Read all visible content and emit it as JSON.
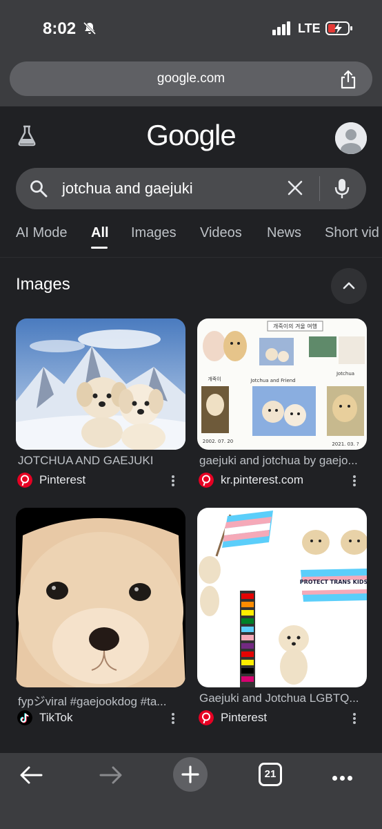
{
  "status_bar": {
    "time": "8:02",
    "network": "LTE"
  },
  "address_bar": {
    "url": "google.com"
  },
  "header": {
    "logo": "Google"
  },
  "search": {
    "query": "jotchua and gaejuki"
  },
  "tabs": [
    {
      "label": "AI Mode"
    },
    {
      "label": "All"
    },
    {
      "label": "Images"
    },
    {
      "label": "Videos"
    },
    {
      "label": "News"
    },
    {
      "label": "Short vid"
    }
  ],
  "active_tab": "All",
  "images_section": {
    "title": "Images",
    "results": [
      {
        "caption": "JOTCHUA AND GAEJUKI",
        "source": "Pinterest",
        "source_icon": "pinterest-icon"
      },
      {
        "caption": "gaejuki and jotchua by gaejo...",
        "source": "kr.pinterest.com",
        "source_icon": "pinterest-icon"
      },
      {
        "caption": "fypジviral #gaejookdog #ta...",
        "source": "TikTok",
        "source_icon": "tiktok-icon"
      },
      {
        "caption": "Gaejuki and Jotchua LGBTQ...",
        "source": "Pinterest",
        "source_icon": "pinterest-icon"
      }
    ],
    "image_text": {
      "collage_header": "개죽이의 겨울 여행",
      "collage_mid": "Jotchua and Friend",
      "collage_left": "개죽이",
      "collage_right": "Jotchua",
      "collage_date1": "2002. 07. 20",
      "collage_date2": "2021. 03. ?",
      "banner": "PROTECT TRANS KIDS"
    }
  },
  "bottom_bar": {
    "tab_count": "21"
  },
  "colors": {
    "background": "#202124",
    "chrome": "#3c3d40",
    "pinterest": "#e60023"
  }
}
